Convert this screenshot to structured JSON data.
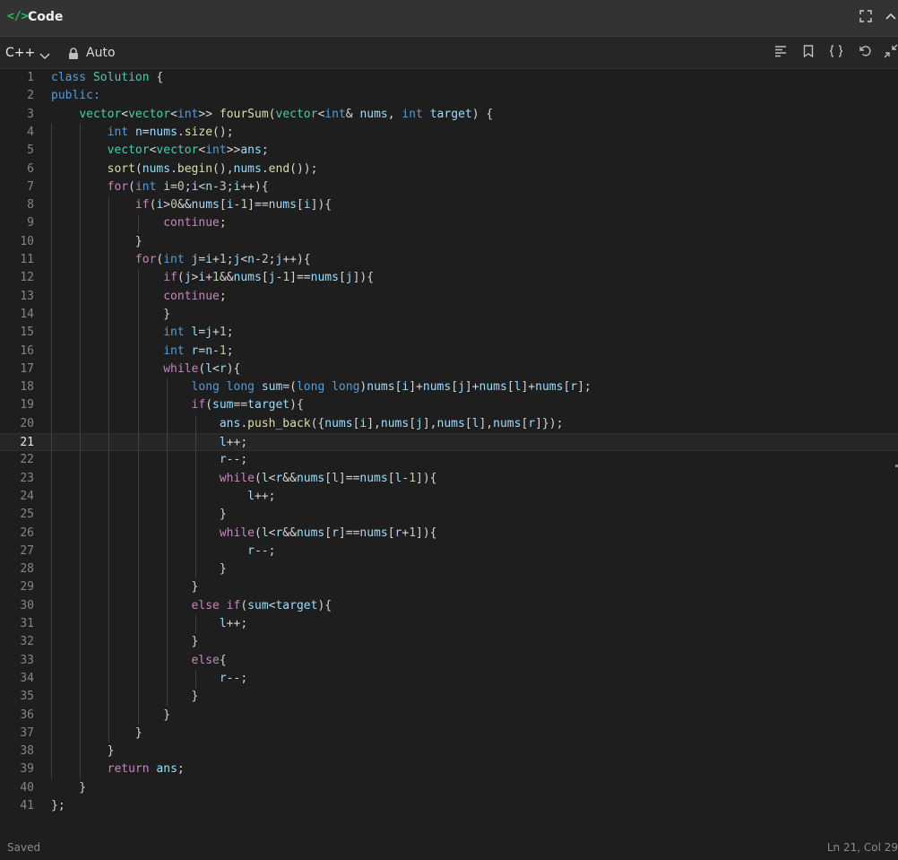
{
  "header": {
    "title": "Code",
    "code_glyph": "</>",
    "icons": [
      "code-icon",
      "fullscreen-icon",
      "collapse-icon"
    ]
  },
  "toolbar": {
    "language": "C++",
    "mode": "Auto",
    "icons": [
      "lock-icon",
      "format-icon",
      "bookmark-icon",
      "braces-icon",
      "reset-icon",
      "shrink-icon"
    ]
  },
  "editor": {
    "current_line": 21,
    "lines": [
      [
        [
          "k",
          "class "
        ],
        [
          "t",
          "Solution"
        ],
        [
          "p",
          " {"
        ]
      ],
      [
        [
          "k",
          "public:"
        ]
      ],
      [
        [
          "p",
          "    "
        ],
        [
          "t",
          "vector"
        ],
        [
          "p",
          "<"
        ],
        [
          "t",
          "vector"
        ],
        [
          "p",
          "<"
        ],
        [
          "k",
          "int"
        ],
        [
          "p",
          ">> "
        ],
        [
          "f",
          "fourSum"
        ],
        [
          "p",
          "("
        ],
        [
          "t",
          "vector"
        ],
        [
          "p",
          "<"
        ],
        [
          "k",
          "int"
        ],
        [
          "p",
          "& "
        ],
        [
          "v",
          "nums"
        ],
        [
          "p",
          ", "
        ],
        [
          "k",
          "int"
        ],
        [
          "p",
          " "
        ],
        [
          "v",
          "target"
        ],
        [
          "p",
          ") {"
        ]
      ],
      [
        [
          "p",
          "        "
        ],
        [
          "k",
          "int"
        ],
        [
          "p",
          " "
        ],
        [
          "v",
          "n"
        ],
        [
          "p",
          "="
        ],
        [
          "v",
          "nums"
        ],
        [
          "p",
          "."
        ],
        [
          "f",
          "size"
        ],
        [
          "p",
          "();"
        ]
      ],
      [
        [
          "p",
          "        "
        ],
        [
          "t",
          "vector"
        ],
        [
          "p",
          "<"
        ],
        [
          "t",
          "vector"
        ],
        [
          "p",
          "<"
        ],
        [
          "k",
          "int"
        ],
        [
          "p",
          ">>"
        ],
        [
          "v",
          "ans"
        ],
        [
          "p",
          ";"
        ]
      ],
      [
        [
          "p",
          "        "
        ],
        [
          "f",
          "sort"
        ],
        [
          "p",
          "("
        ],
        [
          "v",
          "nums"
        ],
        [
          "p",
          "."
        ],
        [
          "f",
          "begin"
        ],
        [
          "p",
          "(),"
        ],
        [
          "v",
          "nums"
        ],
        [
          "p",
          "."
        ],
        [
          "f",
          "end"
        ],
        [
          "p",
          "());"
        ]
      ],
      [
        [
          "p",
          "        "
        ],
        [
          "c",
          "for"
        ],
        [
          "p",
          "("
        ],
        [
          "k",
          "int"
        ],
        [
          "p",
          " "
        ],
        [
          "v",
          "i"
        ],
        [
          "p",
          "="
        ],
        [
          "n",
          "0"
        ],
        [
          "p",
          ";"
        ],
        [
          "v",
          "i"
        ],
        [
          "p",
          "<"
        ],
        [
          "v",
          "n"
        ],
        [
          "p",
          "-"
        ],
        [
          "n",
          "3"
        ],
        [
          "p",
          ";"
        ],
        [
          "v",
          "i"
        ],
        [
          "p",
          "++){"
        ]
      ],
      [
        [
          "p",
          "            "
        ],
        [
          "c",
          "if"
        ],
        [
          "p",
          "("
        ],
        [
          "v",
          "i"
        ],
        [
          "p",
          ">"
        ],
        [
          "n",
          "0"
        ],
        [
          "p",
          "&&"
        ],
        [
          "v",
          "nums"
        ],
        [
          "p",
          "["
        ],
        [
          "v",
          "i"
        ],
        [
          "p",
          "-"
        ],
        [
          "n",
          "1"
        ],
        [
          "p",
          "]=="
        ],
        [
          "v",
          "nums"
        ],
        [
          "p",
          "["
        ],
        [
          "v",
          "i"
        ],
        [
          "p",
          "]){"
        ]
      ],
      [
        [
          "p",
          "                "
        ],
        [
          "c",
          "continue"
        ],
        [
          "p",
          ";"
        ]
      ],
      [
        [
          "p",
          "            }"
        ]
      ],
      [
        [
          "p",
          "            "
        ],
        [
          "c",
          "for"
        ],
        [
          "p",
          "("
        ],
        [
          "k",
          "int"
        ],
        [
          "p",
          " "
        ],
        [
          "v",
          "j"
        ],
        [
          "p",
          "="
        ],
        [
          "v",
          "i"
        ],
        [
          "p",
          "+"
        ],
        [
          "n",
          "1"
        ],
        [
          "p",
          ";"
        ],
        [
          "v",
          "j"
        ],
        [
          "p",
          "<"
        ],
        [
          "v",
          "n"
        ],
        [
          "p",
          "-"
        ],
        [
          "n",
          "2"
        ],
        [
          "p",
          ";"
        ],
        [
          "v",
          "j"
        ],
        [
          "p",
          "++){"
        ]
      ],
      [
        [
          "p",
          "                "
        ],
        [
          "c",
          "if"
        ],
        [
          "p",
          "("
        ],
        [
          "v",
          "j"
        ],
        [
          "p",
          ">"
        ],
        [
          "v",
          "i"
        ],
        [
          "p",
          "+"
        ],
        [
          "n",
          "1"
        ],
        [
          "p",
          "&&"
        ],
        [
          "v",
          "nums"
        ],
        [
          "p",
          "["
        ],
        [
          "v",
          "j"
        ],
        [
          "p",
          "-"
        ],
        [
          "n",
          "1"
        ],
        [
          "p",
          "]=="
        ],
        [
          "v",
          "nums"
        ],
        [
          "p",
          "["
        ],
        [
          "v",
          "j"
        ],
        [
          "p",
          "]){"
        ]
      ],
      [
        [
          "p",
          "                "
        ],
        [
          "c",
          "continue"
        ],
        [
          "p",
          ";"
        ]
      ],
      [
        [
          "p",
          "                }"
        ]
      ],
      [
        [
          "p",
          "                "
        ],
        [
          "k",
          "int"
        ],
        [
          "p",
          " "
        ],
        [
          "v",
          "l"
        ],
        [
          "p",
          "="
        ],
        [
          "v",
          "j"
        ],
        [
          "p",
          "+"
        ],
        [
          "n",
          "1"
        ],
        [
          "p",
          ";"
        ]
      ],
      [
        [
          "p",
          "                "
        ],
        [
          "k",
          "int"
        ],
        [
          "p",
          " "
        ],
        [
          "v",
          "r"
        ],
        [
          "p",
          "="
        ],
        [
          "v",
          "n"
        ],
        [
          "p",
          "-"
        ],
        [
          "n",
          "1"
        ],
        [
          "p",
          ";"
        ]
      ],
      [
        [
          "p",
          "                "
        ],
        [
          "c",
          "while"
        ],
        [
          "p",
          "("
        ],
        [
          "v",
          "l"
        ],
        [
          "p",
          "<"
        ],
        [
          "v",
          "r"
        ],
        [
          "p",
          "){"
        ]
      ],
      [
        [
          "p",
          "                    "
        ],
        [
          "k",
          "long long"
        ],
        [
          "p",
          " "
        ],
        [
          "v",
          "sum"
        ],
        [
          "p",
          "=("
        ],
        [
          "k",
          "long long"
        ],
        [
          "p",
          ")"
        ],
        [
          "v",
          "nums"
        ],
        [
          "p",
          "["
        ],
        [
          "v",
          "i"
        ],
        [
          "p",
          "]+"
        ],
        [
          "v",
          "nums"
        ],
        [
          "p",
          "["
        ],
        [
          "v",
          "j"
        ],
        [
          "p",
          "]+"
        ],
        [
          "v",
          "nums"
        ],
        [
          "p",
          "["
        ],
        [
          "v",
          "l"
        ],
        [
          "p",
          "]+"
        ],
        [
          "v",
          "nums"
        ],
        [
          "p",
          "["
        ],
        [
          "v",
          "r"
        ],
        [
          "p",
          "];"
        ]
      ],
      [
        [
          "p",
          "                    "
        ],
        [
          "c",
          "if"
        ],
        [
          "p",
          "("
        ],
        [
          "v",
          "sum"
        ],
        [
          "p",
          "=="
        ],
        [
          "v",
          "target"
        ],
        [
          "p",
          "){"
        ]
      ],
      [
        [
          "p",
          "                        "
        ],
        [
          "v",
          "ans"
        ],
        [
          "p",
          "."
        ],
        [
          "f",
          "push_back"
        ],
        [
          "p",
          "({"
        ],
        [
          "v",
          "nums"
        ],
        [
          "p",
          "["
        ],
        [
          "v",
          "i"
        ],
        [
          "p",
          "],"
        ],
        [
          "v",
          "nums"
        ],
        [
          "p",
          "["
        ],
        [
          "v",
          "j"
        ],
        [
          "p",
          "],"
        ],
        [
          "v",
          "nums"
        ],
        [
          "p",
          "["
        ],
        [
          "v",
          "l"
        ],
        [
          "p",
          "],"
        ],
        [
          "v",
          "nums"
        ],
        [
          "p",
          "["
        ],
        [
          "v",
          "r"
        ],
        [
          "p",
          "]});"
        ]
      ],
      [
        [
          "p",
          "                        "
        ],
        [
          "v",
          "l"
        ],
        [
          "p",
          "++;"
        ]
      ],
      [
        [
          "p",
          "                        "
        ],
        [
          "v",
          "r"
        ],
        [
          "p",
          "--;"
        ]
      ],
      [
        [
          "p",
          "                        "
        ],
        [
          "c",
          "while"
        ],
        [
          "p",
          "("
        ],
        [
          "v",
          "l"
        ],
        [
          "p",
          "<"
        ],
        [
          "v",
          "r"
        ],
        [
          "p",
          "&&"
        ],
        [
          "v",
          "nums"
        ],
        [
          "p",
          "["
        ],
        [
          "v",
          "l"
        ],
        [
          "p",
          "]=="
        ],
        [
          "v",
          "nums"
        ],
        [
          "p",
          "["
        ],
        [
          "v",
          "l"
        ],
        [
          "p",
          "-"
        ],
        [
          "n",
          "1"
        ],
        [
          "p",
          "]){"
        ]
      ],
      [
        [
          "p",
          "                            "
        ],
        [
          "v",
          "l"
        ],
        [
          "p",
          "++;"
        ]
      ],
      [
        [
          "p",
          "                        }"
        ]
      ],
      [
        [
          "p",
          "                        "
        ],
        [
          "c",
          "while"
        ],
        [
          "p",
          "("
        ],
        [
          "v",
          "l"
        ],
        [
          "p",
          "<"
        ],
        [
          "v",
          "r"
        ],
        [
          "p",
          "&&"
        ],
        [
          "v",
          "nums"
        ],
        [
          "p",
          "["
        ],
        [
          "v",
          "r"
        ],
        [
          "p",
          "]=="
        ],
        [
          "v",
          "nums"
        ],
        [
          "p",
          "["
        ],
        [
          "v",
          "r"
        ],
        [
          "p",
          "+"
        ],
        [
          "n",
          "1"
        ],
        [
          "p",
          "]){"
        ]
      ],
      [
        [
          "p",
          "                            "
        ],
        [
          "v",
          "r"
        ],
        [
          "p",
          "--;"
        ]
      ],
      [
        [
          "p",
          "                        }"
        ]
      ],
      [
        [
          "p",
          "                    }"
        ]
      ],
      [
        [
          "p",
          "                    "
        ],
        [
          "c",
          "else if"
        ],
        [
          "p",
          "("
        ],
        [
          "v",
          "sum"
        ],
        [
          "p",
          "<"
        ],
        [
          "v",
          "target"
        ],
        [
          "p",
          "){"
        ]
      ],
      [
        [
          "p",
          "                        "
        ],
        [
          "v",
          "l"
        ],
        [
          "p",
          "++;"
        ]
      ],
      [
        [
          "p",
          "                    }"
        ]
      ],
      [
        [
          "p",
          "                    "
        ],
        [
          "c",
          "else"
        ],
        [
          "p",
          "{"
        ]
      ],
      [
        [
          "p",
          "                        "
        ],
        [
          "v",
          "r"
        ],
        [
          "p",
          "--;"
        ]
      ],
      [
        [
          "p",
          "                    }"
        ]
      ],
      [
        [
          "p",
          "                }"
        ]
      ],
      [
        [
          "p",
          "            }"
        ]
      ],
      [
        [
          "p",
          "        }"
        ]
      ],
      [
        [
          "p",
          "        "
        ],
        [
          "c",
          "return"
        ],
        [
          "p",
          " "
        ],
        [
          "v",
          "ans"
        ],
        [
          "p",
          ";"
        ]
      ],
      [
        [
          "p",
          "    }"
        ]
      ],
      [
        [
          "p",
          "};"
        ]
      ]
    ]
  },
  "status": {
    "left": "Saved",
    "right": "Ln 21, Col 29"
  },
  "colors": {
    "keyword": "#569cd6",
    "control": "#c586c0",
    "function": "#dcdcaa",
    "type": "#4ec9b0",
    "variable": "#9cdcfe",
    "number": "#b5cea8",
    "accent": "#2cbb5d"
  }
}
